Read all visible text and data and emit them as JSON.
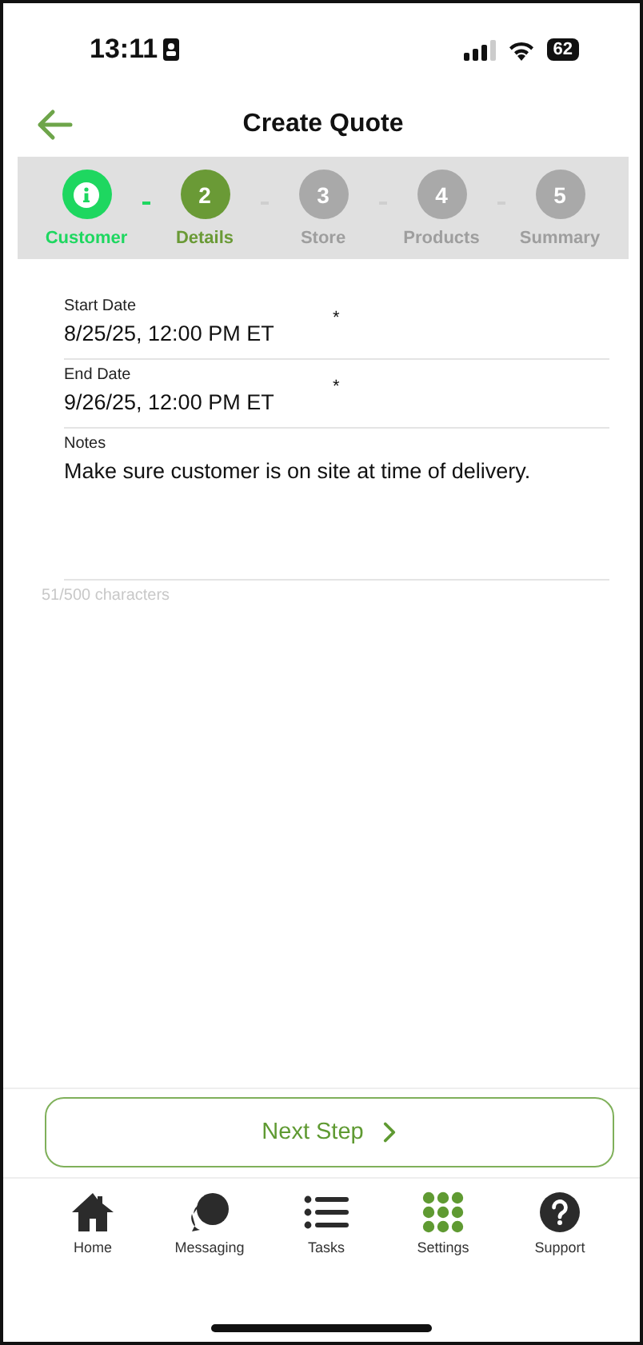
{
  "status_bar": {
    "time": "13:11",
    "battery": "62"
  },
  "header": {
    "title": "Create Quote"
  },
  "steps": [
    {
      "label": "Customer",
      "completed": true,
      "selected": false
    },
    {
      "label": "Details",
      "number": "2",
      "completed": false,
      "selected": true
    },
    {
      "label": "Store",
      "number": "3",
      "completed": false,
      "selected": false
    },
    {
      "label": "Products",
      "number": "4",
      "completed": false,
      "selected": false
    },
    {
      "label": "Summary",
      "number": "5",
      "completed": false,
      "selected": false
    }
  ],
  "fields": [
    {
      "label": "Start Date",
      "value": "8/25/25, 12:00 PM ET",
      "required_mark": "*",
      "kind": "date"
    },
    {
      "label": "End Date",
      "value": "9/26/25, 12:00 PM ET",
      "required_mark": "*",
      "kind": "date"
    },
    {
      "label": "Notes",
      "value": "Make sure customer is on site at time of delivery.",
      "kind": "notes"
    }
  ],
  "counter": "51/500 characters",
  "next_button": {
    "label": "Next Step"
  },
  "tabs": [
    {
      "label": "Home",
      "selected": false
    },
    {
      "label": "Messaging",
      "selected": false
    },
    {
      "label": "Tasks",
      "selected": false
    },
    {
      "label": "Settings",
      "selected": true
    },
    {
      "label": "Support",
      "selected": false
    }
  ]
}
